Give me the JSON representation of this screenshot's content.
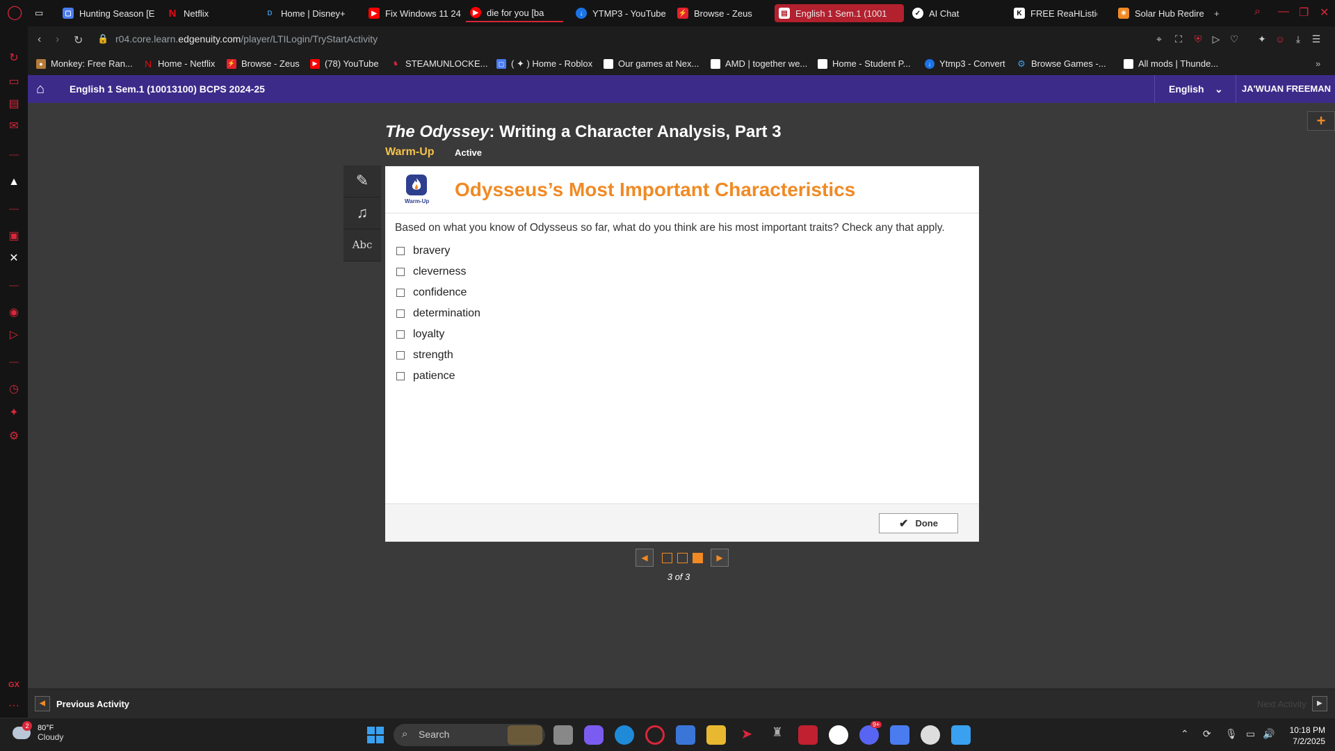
{
  "browser": {
    "tabs": [
      {
        "label": "Hunting Season [E",
        "color": "#4a7cf0"
      },
      {
        "label": "Netflix",
        "color": "#e50914"
      },
      {
        "label": "Home | Disney+",
        "color": "#0b3c8c"
      },
      {
        "label": "Fix Windows 11 24",
        "color": "#ff0000"
      },
      {
        "label": "die for you [ba",
        "color": "#ff0000"
      },
      {
        "label": "YTMP3 - YouTube",
        "color": "#1a73e8"
      },
      {
        "label": "Browse - Zeus",
        "color": "#e5202e"
      },
      {
        "label": "English 1 Sem.1 (1001",
        "color": "#ffffff"
      },
      {
        "label": "AI Chat",
        "color": "#ffffff"
      },
      {
        "label": "FREE ReaHListic I",
        "color": "#ffffff"
      },
      {
        "label": "Solar Hub Redirec",
        "color": "#f08a24"
      }
    ],
    "url_prefix": "r04.core.learn.",
    "url_domain": "edgenuity.com",
    "url_path": "/player/LTILogin/TryStartActivity",
    "bookmarks": [
      "Monkey: Free Ran...",
      "Home - Netflix",
      "Browse - Zeus",
      "(78) YouTube",
      "STEAMUNLOCKE...",
      "( ✦ ) Home - Roblox",
      "Our games at Nex...",
      "AMD | together we...",
      "Home - Student P...",
      "Ytmp3 - Convert",
      "Browse Games -...",
      "All mods | Thunde..."
    ],
    "sidebar_badge": "GX"
  },
  "app": {
    "course_title": "English 1 Sem.1 (10013100) BCPS 2024-25",
    "language": "English",
    "user_name": "JA'WUAN FREEMAN",
    "lesson_title_italic": "The Odyssey",
    "lesson_title_rest": ": Writing a Character Analysis, Part 3",
    "activity_type": "Warm-Up",
    "activity_status": "Active",
    "card_icon_label": "Warm-Up",
    "card_title": "Odysseus’s Most Important Characteristics",
    "prompt": "Based on what you know of Odysseus so far, what do you think are his most important traits? Check any that apply.",
    "options": [
      "bravery",
      "cleverness",
      "confidence",
      "determination",
      "loyalty",
      "strength",
      "patience"
    ],
    "done_label": "Done",
    "page_count": "3 of 3",
    "prev_label": "Previous Activity",
    "next_label": "Next Activity",
    "accent": "#f08a24",
    "header_bg": "#3d2b8a"
  },
  "taskbar": {
    "temp": "80°F",
    "condition": "Cloudy",
    "weather_badge": "2",
    "search_placeholder": "Search",
    "discord_badge": "9+",
    "time": "10:18 PM",
    "date": "7/2/2025"
  }
}
